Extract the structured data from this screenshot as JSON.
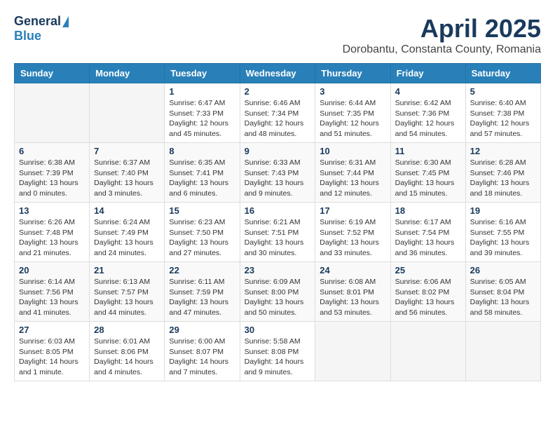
{
  "logo": {
    "general": "General",
    "blue": "Blue"
  },
  "title": "April 2025",
  "subtitle": "Dorobantu, Constanta County, Romania",
  "weekdays": [
    "Sunday",
    "Monday",
    "Tuesday",
    "Wednesday",
    "Thursday",
    "Friday",
    "Saturday"
  ],
  "weeks": [
    [
      {
        "day": "",
        "info": ""
      },
      {
        "day": "",
        "info": ""
      },
      {
        "day": "1",
        "info": "Sunrise: 6:47 AM\nSunset: 7:33 PM\nDaylight: 12 hours\nand 45 minutes."
      },
      {
        "day": "2",
        "info": "Sunrise: 6:46 AM\nSunset: 7:34 PM\nDaylight: 12 hours\nand 48 minutes."
      },
      {
        "day": "3",
        "info": "Sunrise: 6:44 AM\nSunset: 7:35 PM\nDaylight: 12 hours\nand 51 minutes."
      },
      {
        "day": "4",
        "info": "Sunrise: 6:42 AM\nSunset: 7:36 PM\nDaylight: 12 hours\nand 54 minutes."
      },
      {
        "day": "5",
        "info": "Sunrise: 6:40 AM\nSunset: 7:38 PM\nDaylight: 12 hours\nand 57 minutes."
      }
    ],
    [
      {
        "day": "6",
        "info": "Sunrise: 6:38 AM\nSunset: 7:39 PM\nDaylight: 13 hours\nand 0 minutes."
      },
      {
        "day": "7",
        "info": "Sunrise: 6:37 AM\nSunset: 7:40 PM\nDaylight: 13 hours\nand 3 minutes."
      },
      {
        "day": "8",
        "info": "Sunrise: 6:35 AM\nSunset: 7:41 PM\nDaylight: 13 hours\nand 6 minutes."
      },
      {
        "day": "9",
        "info": "Sunrise: 6:33 AM\nSunset: 7:43 PM\nDaylight: 13 hours\nand 9 minutes."
      },
      {
        "day": "10",
        "info": "Sunrise: 6:31 AM\nSunset: 7:44 PM\nDaylight: 13 hours\nand 12 minutes."
      },
      {
        "day": "11",
        "info": "Sunrise: 6:30 AM\nSunset: 7:45 PM\nDaylight: 13 hours\nand 15 minutes."
      },
      {
        "day": "12",
        "info": "Sunrise: 6:28 AM\nSunset: 7:46 PM\nDaylight: 13 hours\nand 18 minutes."
      }
    ],
    [
      {
        "day": "13",
        "info": "Sunrise: 6:26 AM\nSunset: 7:48 PM\nDaylight: 13 hours\nand 21 minutes."
      },
      {
        "day": "14",
        "info": "Sunrise: 6:24 AM\nSunset: 7:49 PM\nDaylight: 13 hours\nand 24 minutes."
      },
      {
        "day": "15",
        "info": "Sunrise: 6:23 AM\nSunset: 7:50 PM\nDaylight: 13 hours\nand 27 minutes."
      },
      {
        "day": "16",
        "info": "Sunrise: 6:21 AM\nSunset: 7:51 PM\nDaylight: 13 hours\nand 30 minutes."
      },
      {
        "day": "17",
        "info": "Sunrise: 6:19 AM\nSunset: 7:52 PM\nDaylight: 13 hours\nand 33 minutes."
      },
      {
        "day": "18",
        "info": "Sunrise: 6:17 AM\nSunset: 7:54 PM\nDaylight: 13 hours\nand 36 minutes."
      },
      {
        "day": "19",
        "info": "Sunrise: 6:16 AM\nSunset: 7:55 PM\nDaylight: 13 hours\nand 39 minutes."
      }
    ],
    [
      {
        "day": "20",
        "info": "Sunrise: 6:14 AM\nSunset: 7:56 PM\nDaylight: 13 hours\nand 41 minutes."
      },
      {
        "day": "21",
        "info": "Sunrise: 6:13 AM\nSunset: 7:57 PM\nDaylight: 13 hours\nand 44 minutes."
      },
      {
        "day": "22",
        "info": "Sunrise: 6:11 AM\nSunset: 7:59 PM\nDaylight: 13 hours\nand 47 minutes."
      },
      {
        "day": "23",
        "info": "Sunrise: 6:09 AM\nSunset: 8:00 PM\nDaylight: 13 hours\nand 50 minutes."
      },
      {
        "day": "24",
        "info": "Sunrise: 6:08 AM\nSunset: 8:01 PM\nDaylight: 13 hours\nand 53 minutes."
      },
      {
        "day": "25",
        "info": "Sunrise: 6:06 AM\nSunset: 8:02 PM\nDaylight: 13 hours\nand 56 minutes."
      },
      {
        "day": "26",
        "info": "Sunrise: 6:05 AM\nSunset: 8:04 PM\nDaylight: 13 hours\nand 58 minutes."
      }
    ],
    [
      {
        "day": "27",
        "info": "Sunrise: 6:03 AM\nSunset: 8:05 PM\nDaylight: 14 hours\nand 1 minute."
      },
      {
        "day": "28",
        "info": "Sunrise: 6:01 AM\nSunset: 8:06 PM\nDaylight: 14 hours\nand 4 minutes."
      },
      {
        "day": "29",
        "info": "Sunrise: 6:00 AM\nSunset: 8:07 PM\nDaylight: 14 hours\nand 7 minutes."
      },
      {
        "day": "30",
        "info": "Sunrise: 5:58 AM\nSunset: 8:08 PM\nDaylight: 14 hours\nand 9 minutes."
      },
      {
        "day": "",
        "info": ""
      },
      {
        "day": "",
        "info": ""
      },
      {
        "day": "",
        "info": ""
      }
    ]
  ]
}
